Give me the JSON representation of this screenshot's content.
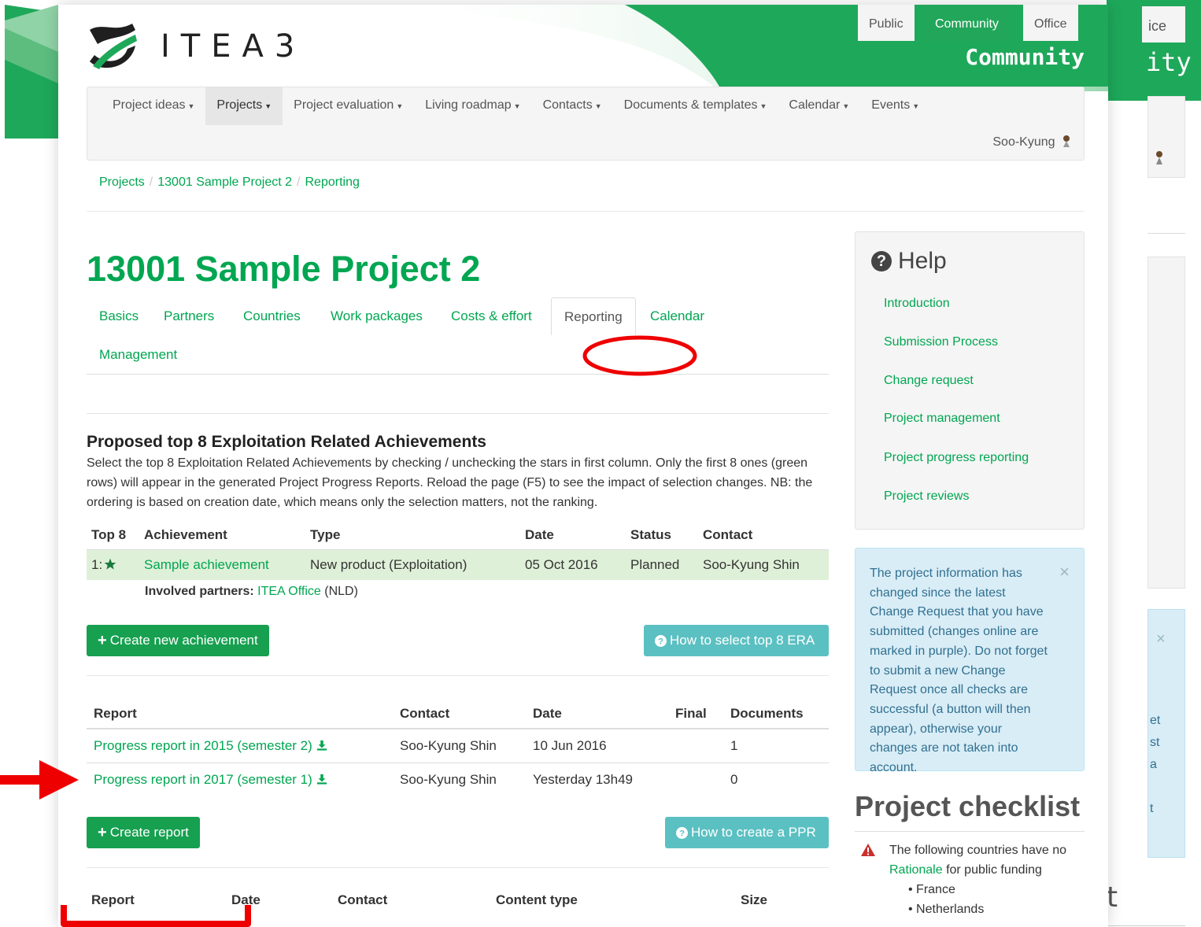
{
  "site": {
    "logo_text": "ITEA3",
    "site_tabs": [
      "Public",
      "Community",
      "Office"
    ],
    "site_title": "Community",
    "accent": "#00a651"
  },
  "navbar": {
    "items": [
      "Project ideas",
      "Projects",
      "Project evaluation",
      "Living roadmap",
      "Contacts",
      "Documents & templates",
      "Calendar",
      "Events"
    ],
    "active": "Projects",
    "user": "Soo-Kyung"
  },
  "breadcrumb": [
    "Projects",
    "13001 Sample Project 2",
    "Reporting"
  ],
  "project": {
    "title": "13001 Sample Project 2",
    "tabs": [
      "Basics",
      "Partners",
      "Countries",
      "Work packages",
      "Costs & effort",
      "Reporting",
      "Calendar",
      "Management"
    ],
    "active_tab": "Reporting"
  },
  "era": {
    "title": "Proposed top 8 Exploitation Related Achievements",
    "description": "Select the top 8 Exploitation Related Achievements by checking / unchecking the stars in first column. Only the first 8 ones (green rows) will appear in the generated Project Progress Reports. Reload the page (F5) to see the impact of selection changes. NB: the ordering is based on creation date, which means only the selection matters, not the ranking.",
    "columns": [
      "Top 8",
      "Achievement",
      "Type",
      "Date",
      "Status",
      "Contact"
    ],
    "rows": [
      {
        "top": "1:",
        "achievement": "Sample achievement",
        "type": "New product (Exploitation)",
        "date": "05 Oct 2016",
        "status": "Planned",
        "contact": "Soo-Kyung Shin"
      }
    ],
    "partners_label": "Involved partners:",
    "partners_link": "ITEA Office",
    "partners_country": "(NLD)",
    "create_button": "Create new achievement",
    "help_button": "How to select top 8 ERA"
  },
  "reports": {
    "columns": [
      "Report",
      "Contact",
      "Date",
      "Final",
      "Documents"
    ],
    "rows": [
      {
        "report": "Progress report in 2015 (semester 2)",
        "contact": "Soo-Kyung Shin",
        "date": "10 Jun 2016",
        "final": "",
        "documents": "1"
      },
      {
        "report": "Progress report in 2017 (semester 1)",
        "contact": "Soo-Kyung Shin",
        "date": "Yesterday 13h49",
        "final": "",
        "documents": "0"
      }
    ],
    "create_button": "Create report",
    "help_button": "How to create a PPR"
  },
  "documents": {
    "columns": [
      "Report",
      "Date",
      "Contact",
      "Content type",
      "Size"
    ]
  },
  "help": {
    "title": "Help",
    "links": [
      "Introduction",
      "Submission Process",
      "Change request",
      "Project management",
      "Project progress reporting",
      "Project reviews"
    ]
  },
  "alert": {
    "text": "The project information has changed since the latest Change Request that you have submitted (changes online are marked in purple). Do not forget to submit a new Change Request once all checks are successful (a button will then appear), otherwise your changes are not taken into account.",
    "close": "×"
  },
  "checklist": {
    "title": "Project checklist",
    "item_prefix": "The following countries have no",
    "item_link": "Rationale",
    "item_suffix": "for public funding",
    "countries": [
      "France",
      "Netherlands"
    ]
  },
  "ghost": {
    "tab": "ice",
    "title": "ity",
    "close": "×",
    "alert_frags": [
      "et",
      "st",
      "a",
      "t"
    ],
    "checklist_frag": "t"
  }
}
